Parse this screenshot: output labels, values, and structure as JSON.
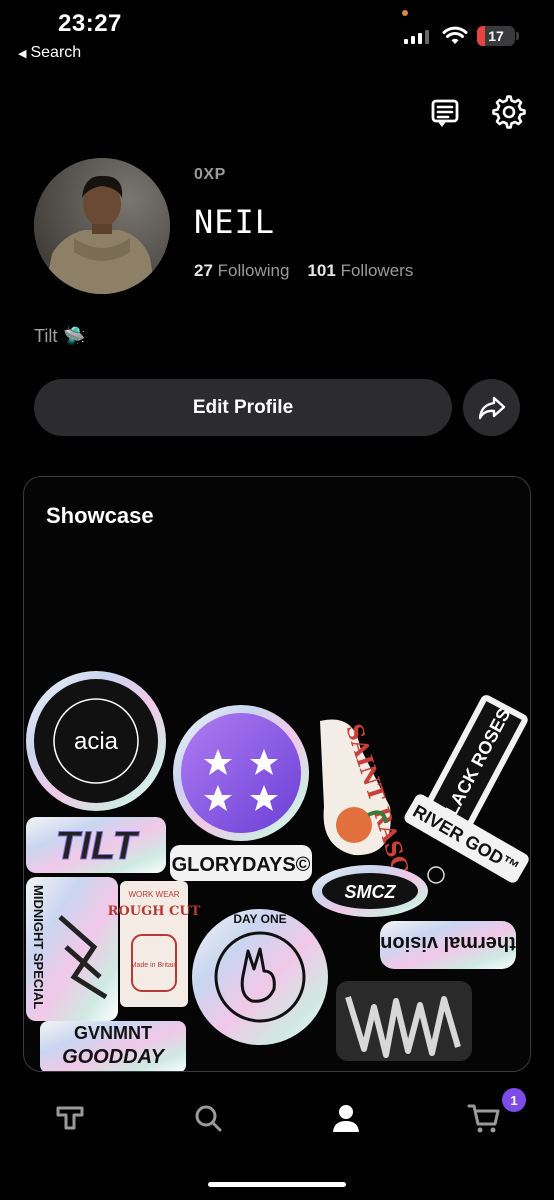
{
  "status_bar": {
    "time": "23:27",
    "back_label": "Search",
    "battery_level": "17"
  },
  "header": {
    "messages_icon": "receipt-icon",
    "settings_icon": "gear-icon"
  },
  "profile": {
    "xp": "0XP",
    "username": "NEIL",
    "following_count": "27",
    "following_label": "Following",
    "followers_count": "101",
    "followers_label": "Followers",
    "bio": "Tilt",
    "bio_emoji": "🛸"
  },
  "actions": {
    "edit_profile_label": "Edit Profile",
    "share_icon": "share-arrow-icon"
  },
  "showcase": {
    "title": "Showcase",
    "stickers": {
      "acia": "acia",
      "tilt": "TILT",
      "glorydays": "GLORYDAYS©",
      "saint_rascal": "SAINT RASCAL",
      "black_roses": "BLACK ROSES",
      "river_god": "RIVER GOD™",
      "smcz": "SMCZ",
      "thermal_vision": "thermal vision",
      "midnight_special": "MIDNIGHT SPECIAL",
      "rough_cut": "ROUGH CUT",
      "rough_cut_top": "WORK WEAR",
      "rough_cut_made": "Made in Britain",
      "day_one": "DAY ONE",
      "gvnmnt": "GVNMNT",
      "goodday": "GOODDAY"
    }
  },
  "tabbar": {
    "cart_badge": "1"
  }
}
